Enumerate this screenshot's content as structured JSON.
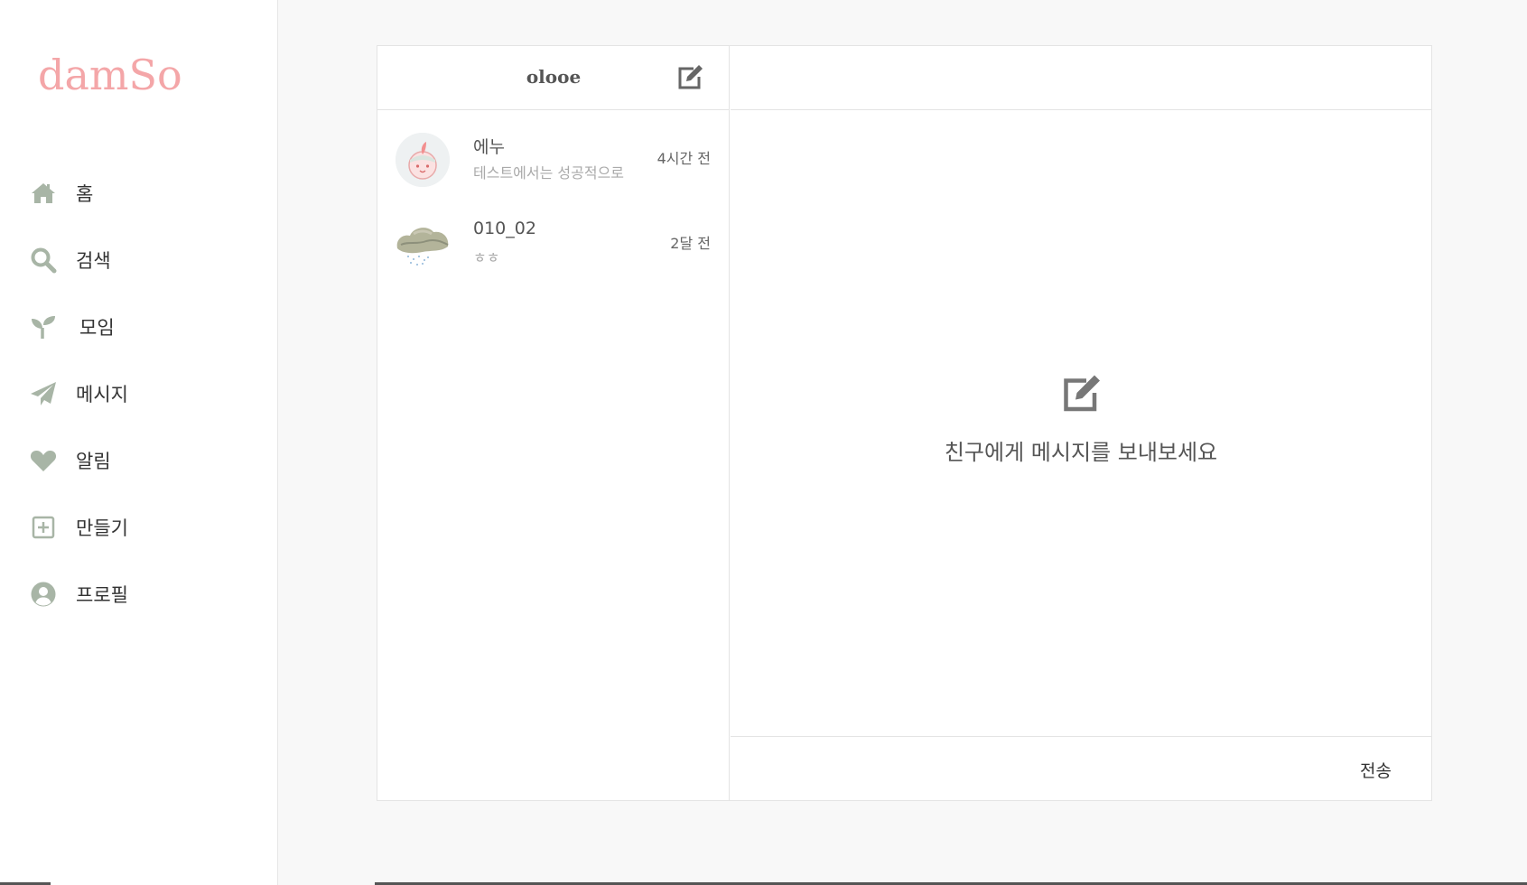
{
  "brand": {
    "logo": "damSo",
    "logo_color": "#f4a6a8"
  },
  "sidebar": {
    "icon_color": "#a8b5a6",
    "items": [
      {
        "label": "홈",
        "icon": "home-icon"
      },
      {
        "label": "검색",
        "icon": "search-icon"
      },
      {
        "label": "모임",
        "icon": "sprout-icon"
      },
      {
        "label": "메시지",
        "icon": "paper-plane-icon"
      },
      {
        "label": "알림",
        "icon": "heart-icon"
      },
      {
        "label": "만들기",
        "icon": "plus-square-icon"
      },
      {
        "label": "프로필",
        "icon": "user-circle-icon"
      }
    ]
  },
  "messages": {
    "username": "olooe",
    "compose_icon": "edit-icon",
    "conversations": [
      {
        "name": "에누",
        "preview": "테스트에서는 성공적으로",
        "time": "4시간 전",
        "avatar": "character-avatar"
      },
      {
        "name": "010_02",
        "preview": "ㅎㅎ",
        "time": "2달 전",
        "avatar": "cloud-avatar"
      }
    ]
  },
  "chat": {
    "empty_icon": "edit-icon",
    "empty_text": "친구에게 메시지를 보내보세요",
    "send_label": "전송"
  }
}
